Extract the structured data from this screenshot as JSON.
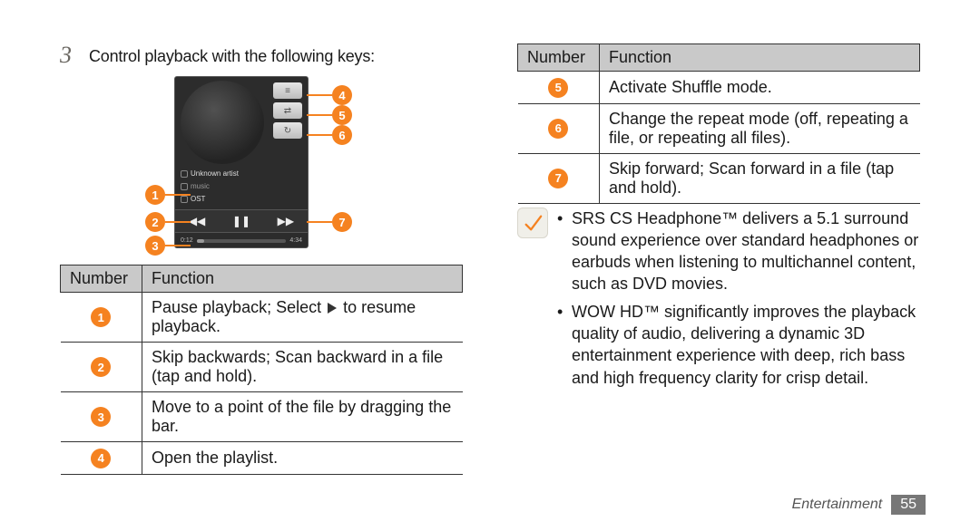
{
  "step": {
    "number": "3",
    "text": "Control playback with the following keys:"
  },
  "player": {
    "artist_line": "Unknown artist",
    "album_line": "music",
    "track_line": "OST",
    "time_cur": "0:12",
    "time_total": "4:34"
  },
  "callouts": {
    "b1": "1",
    "b2": "2",
    "b3": "3",
    "b4": "4",
    "b5": "5",
    "b6": "6",
    "b7": "7"
  },
  "left_table": {
    "head_num": "Number",
    "head_fn": "Function",
    "rows": [
      {
        "n": "1",
        "fn_a": "Pause playback; Select ",
        "fn_b": " to resume playback."
      },
      {
        "n": "2",
        "fn": "Skip backwards; Scan backward in a file (tap and hold)."
      },
      {
        "n": "3",
        "fn": "Move to a point of the file by dragging the bar."
      },
      {
        "n": "4",
        "fn": "Open the playlist."
      }
    ]
  },
  "right_table": {
    "head_num": "Number",
    "head_fn": "Function",
    "rows": [
      {
        "n": "5",
        "fn": "Activate Shuffle mode."
      },
      {
        "n": "6",
        "fn": "Change the repeat mode (off, repeating a file, or repeating all files)."
      },
      {
        "n": "7",
        "fn": "Skip forward; Scan forward in a file (tap and hold)."
      }
    ]
  },
  "note": {
    "items": [
      "SRS CS Headphone™ delivers a 5.1 surround sound experience over standard headphones or earbuds when listening to multichannel content, such as DVD movies.",
      "WOW HD™ significantly improves the playback quality of audio, delivering a dynamic 3D entertainment experience with deep, rich bass and high frequency clarity for crisp detail."
    ]
  },
  "footer": {
    "section": "Entertainment",
    "page": "55"
  }
}
